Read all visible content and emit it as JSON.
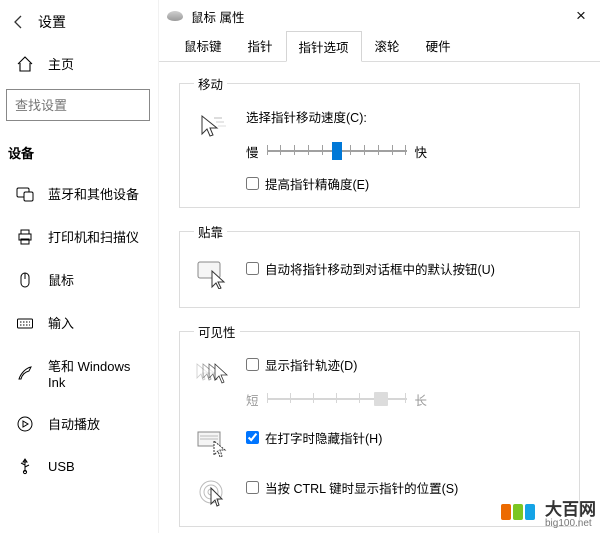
{
  "settings": {
    "title": "设置",
    "home": "主页",
    "search_placeholder": "查找设置",
    "category": "设备",
    "items": [
      {
        "label": "蓝牙和其他设备",
        "icon": "bluetooth-devices-icon"
      },
      {
        "label": "打印机和扫描仪",
        "icon": "printer-icon"
      },
      {
        "label": "鼠标",
        "icon": "mouse-icon"
      },
      {
        "label": "输入",
        "icon": "keyboard-icon"
      },
      {
        "label": "笔和 Windows Ink",
        "icon": "pen-icon"
      },
      {
        "label": "自动播放",
        "icon": "autoplay-icon"
      },
      {
        "label": "USB",
        "icon": "usb-icon"
      }
    ]
  },
  "dialog": {
    "title": "鼠标 属性",
    "tabs": [
      {
        "label": "鼠标键"
      },
      {
        "label": "指针"
      },
      {
        "label": "指针选项",
        "selected": true
      },
      {
        "label": "滚轮"
      },
      {
        "label": "硬件"
      }
    ],
    "motion": {
      "legend": "移动",
      "speed_label": "选择指针移动速度(C):",
      "slow": "慢",
      "fast": "快",
      "enhance": "提高指针精确度(E)",
      "enhance_checked": false,
      "slider_value": 5,
      "slider_min": 1,
      "slider_max": 11
    },
    "snap": {
      "legend": "贴靠",
      "label": "自动将指针移动到对话框中的默认按钮(U)",
      "checked": false
    },
    "visibility": {
      "legend": "可见性",
      "trails_label": "显示指针轨迹(D)",
      "trails_checked": false,
      "trails_short": "短",
      "trails_long": "长",
      "hide_typing_label": "在打字时隐藏指针(H)",
      "hide_typing_checked": true,
      "ctrl_locate_label": "当按 CTRL 键时显示指针的位置(S)",
      "ctrl_locate_checked": false
    }
  },
  "watermark": {
    "brand": "大百网",
    "domain": "big100.net",
    "colors": [
      "#ec6a00",
      "#7cc623",
      "#15a3e6"
    ]
  }
}
